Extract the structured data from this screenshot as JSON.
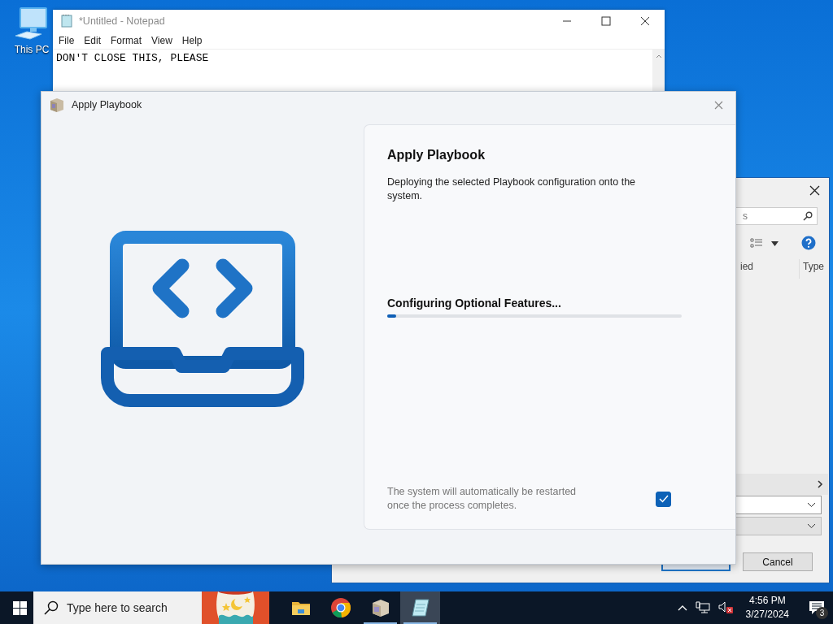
{
  "desktop_icons": [
    {
      "label": "This PC"
    }
  ],
  "notepad": {
    "title": "*Untitled - Notepad",
    "menu": [
      "File",
      "Edit",
      "Format",
      "View",
      "Help"
    ],
    "text": "DON'T CLOSE THIS, PLEASE"
  },
  "file_dialog": {
    "search_placeholder": "s",
    "columns": [
      "ied",
      "Type"
    ],
    "cancel": "Cancel"
  },
  "dialog": {
    "title": "Apply Playbook",
    "heading": "Apply Playbook",
    "description": "Deploying the selected Playbook configuration onto the system.",
    "progress": {
      "label": "Configuring Optional Features...",
      "level": 0.03
    },
    "footer": {
      "text": "The system will automatically be restarted once the process completes.",
      "checked": true
    }
  },
  "taskbar": {
    "search_placeholder": "Type here to search",
    "apps": [
      {
        "kind": "folder",
        "selected": false,
        "running": false
      },
      {
        "kind": "browser",
        "selected": false,
        "running": false
      },
      {
        "kind": "box",
        "selected": false,
        "running": true
      },
      {
        "kind": "notepad",
        "selected": true,
        "running": true
      }
    ],
    "time": "4:56 PM",
    "date": "3/27/2024",
    "notifications": "3"
  }
}
